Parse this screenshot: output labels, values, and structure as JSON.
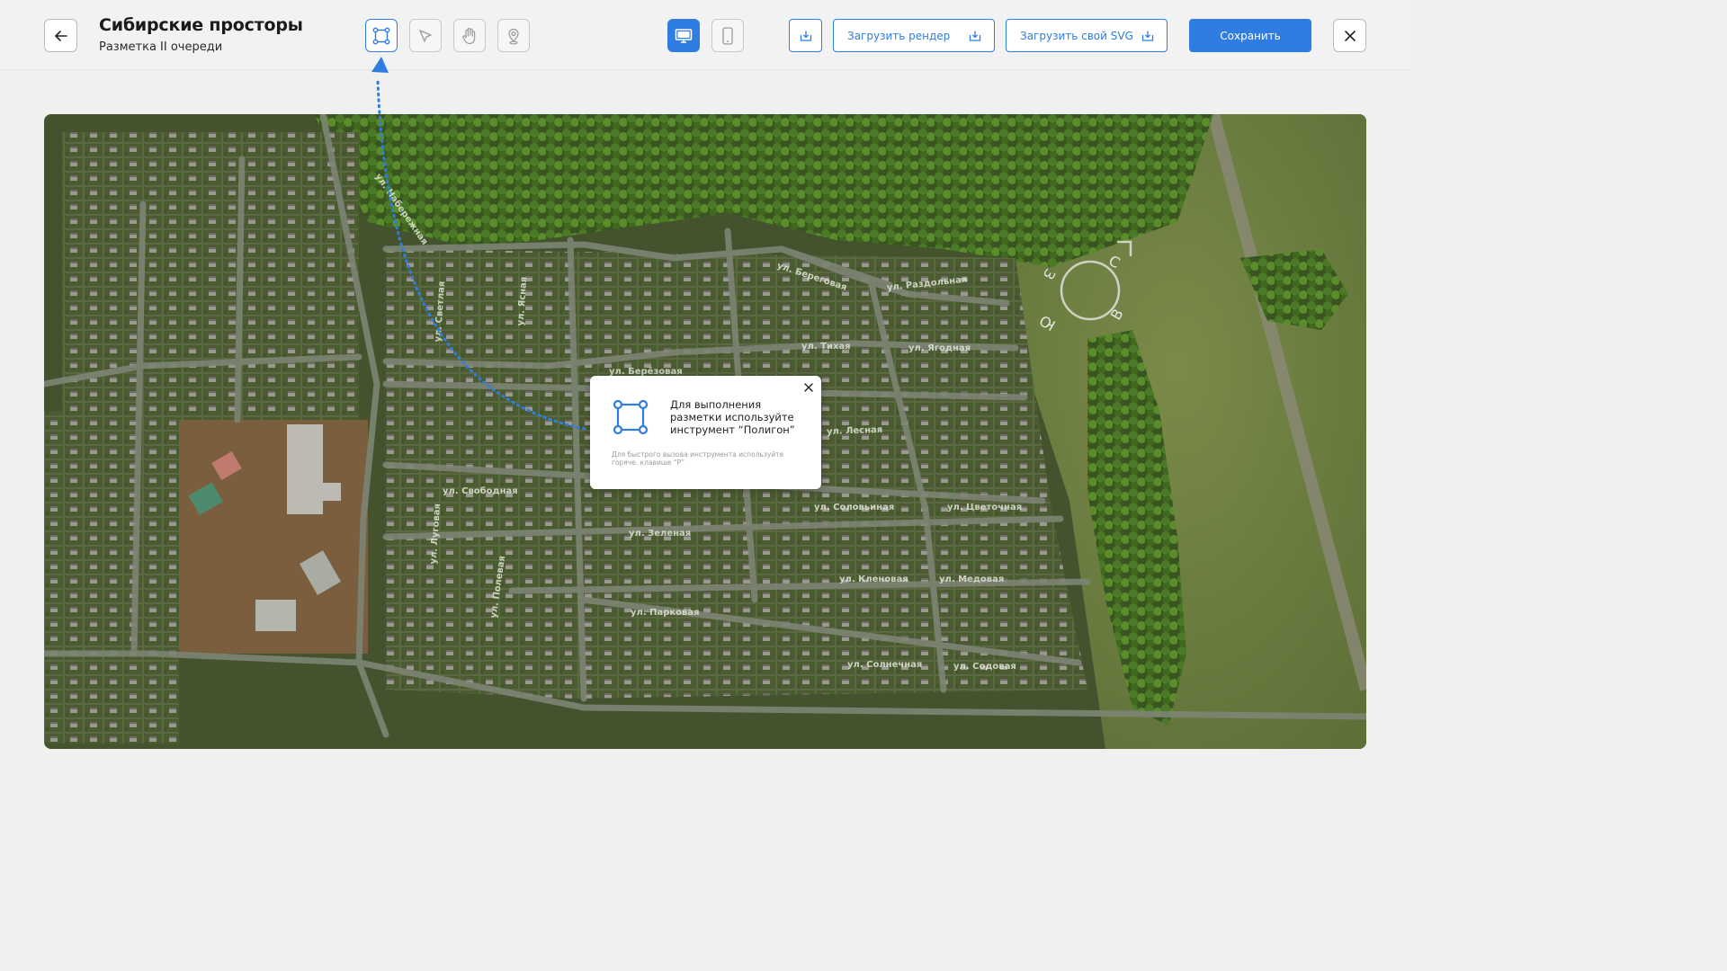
{
  "header": {
    "title": "Сибирские просторы",
    "subtitle": "Разметка II очереди"
  },
  "toolbar": {
    "tools": [
      {
        "name": "polygon",
        "icon": "polygon-icon",
        "active": true
      },
      {
        "name": "pointer",
        "icon": "cursor-icon",
        "active": false
      },
      {
        "name": "hand",
        "icon": "hand-icon",
        "active": false
      },
      {
        "name": "pin",
        "icon": "map-pin-icon",
        "active": false
      }
    ],
    "devices": [
      {
        "name": "desktop",
        "icon": "desktop-icon",
        "active": true
      },
      {
        "name": "mobile",
        "icon": "mobile-icon",
        "active": false
      }
    ],
    "upload_render_label": "Загрузить рендер",
    "upload_svg_label": "Загрузить свой SVG",
    "save_label": "Сохранить"
  },
  "map": {
    "streets": [
      "ул. Набережная",
      "ул. Береговая",
      "ул. Раздольная",
      "ул. Светлая",
      "ул. Ясная",
      "ул. Тихая",
      "ул. Ягодная",
      "ул. Берёзовая",
      "ул. Лесная",
      "ул. Свободная",
      "ул. Соловьиная",
      "ул. Цветочная",
      "ул. Зеленая",
      "ул. Луговая",
      "ул. Кленовая",
      "ул. Медовая",
      "ул. Полевая",
      "ул. Парковая",
      "ул. Солнечная",
      "ул. Содовая"
    ],
    "compass": [
      "С",
      "В",
      "Ю",
      "З"
    ]
  },
  "popup": {
    "text": "Для выполнения разметки используйте инструмент “Полигон”",
    "hint": "Для быстрого вызова инструмента используйте горяче. клавише “P”"
  },
  "colors": {
    "accent": "#2f7de1",
    "map_base": "#44532e"
  }
}
